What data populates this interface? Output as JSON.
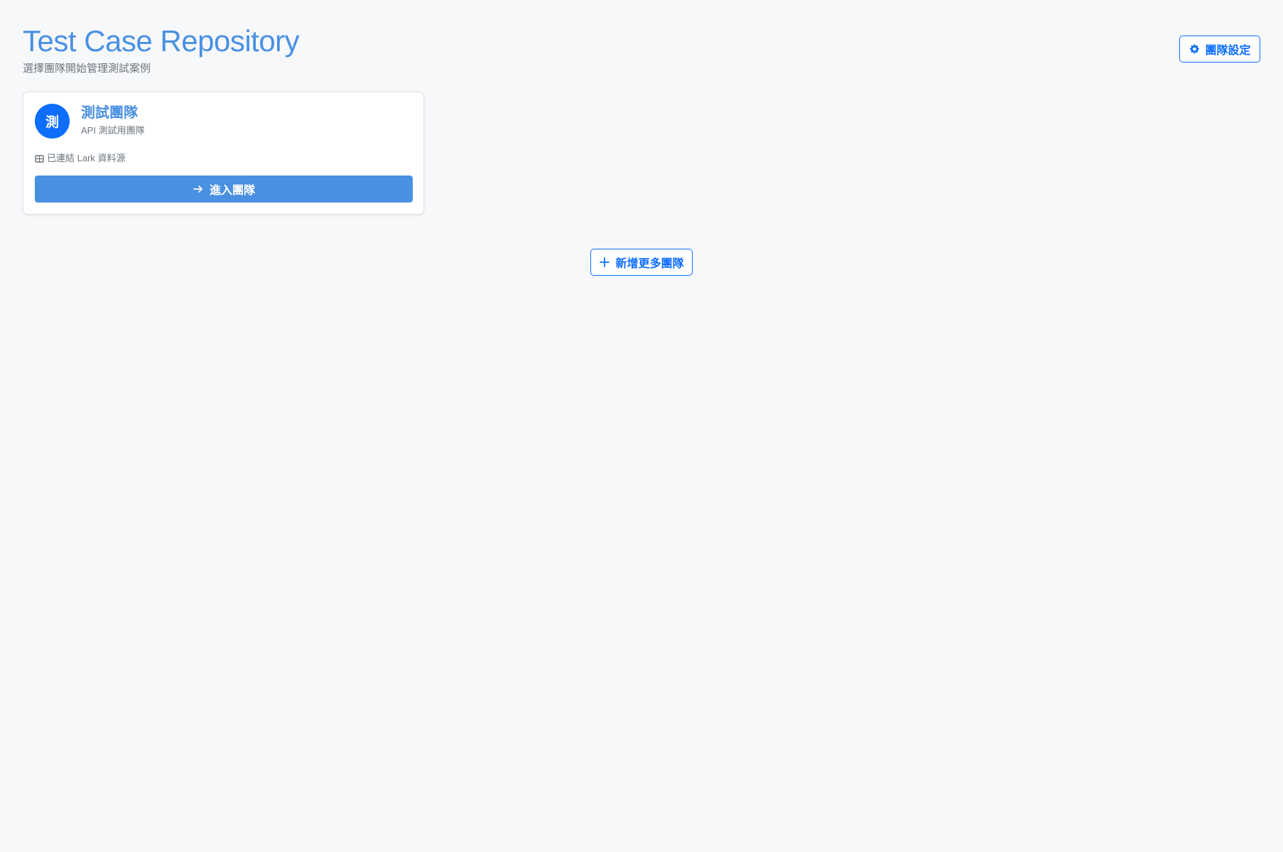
{
  "header": {
    "title": "Test Case Repository",
    "subtitle": "選擇團隊開始管理測試案例"
  },
  "settings_button": {
    "label": "團隊設定",
    "icon": "gear-icon"
  },
  "teams": [
    {
      "avatar_letter": "測",
      "name": "測試團隊",
      "description": "API 測試用團隊",
      "status_icon": "table-icon",
      "status_text": "已連結 Lark 資料源",
      "enter_label": "進入團隊",
      "enter_icon": "arrow-right-icon"
    }
  ],
  "add_team_button": {
    "label": "新增更多團隊",
    "icon": "plus-icon"
  },
  "colors": {
    "background": "#f7f8fa",
    "accent": "#4a90e2",
    "primary": "#0d6efd",
    "muted_text": "#6c757d",
    "card_border": "#dee2e6"
  }
}
